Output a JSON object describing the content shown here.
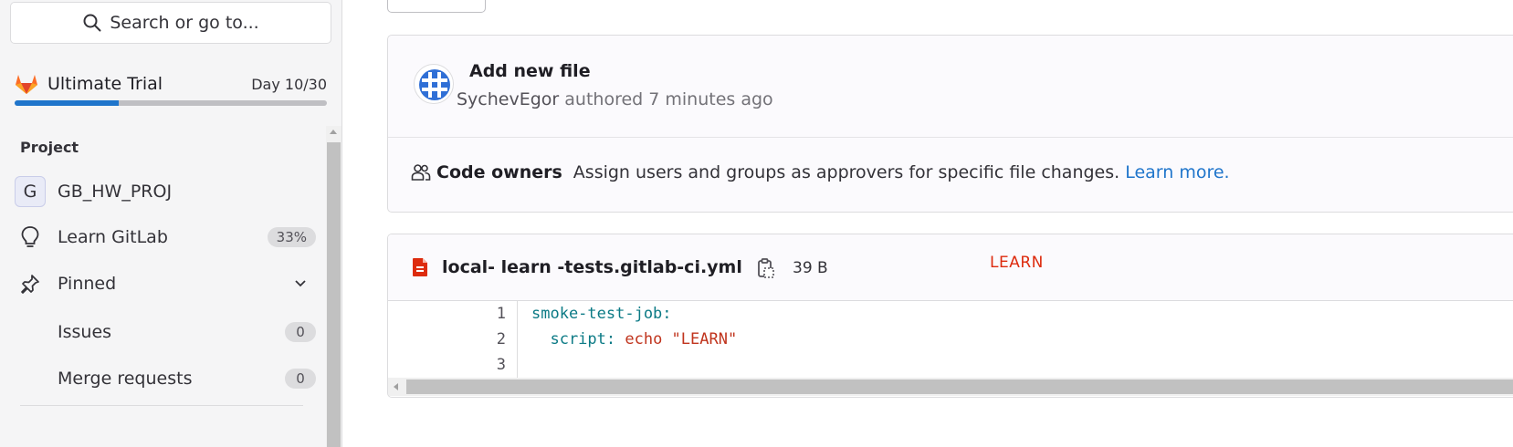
{
  "sidebar": {
    "search_placeholder": "Search or go to...",
    "trial": {
      "title": "Ultimate Trial",
      "day": "Day 10/30",
      "progress": 0.333
    },
    "section_label": "Project",
    "project": {
      "avatar_letter": "G",
      "name": "GB_HW_PROJ"
    },
    "learn": {
      "label": "Learn GitLab",
      "badge": "33%"
    },
    "pinned": {
      "label": "Pinned"
    },
    "pinned_items": [
      {
        "label": "Issues",
        "count": "0"
      },
      {
        "label": "Merge requests",
        "count": "0"
      }
    ]
  },
  "commit": {
    "title": "Add new file",
    "author": "SychevEgor",
    "meta": "authored 7 minutes ago"
  },
  "code_owners": {
    "label": "Code owners",
    "text": "Assign users and groups as approvers for specific file changes.",
    "link": "Learn more."
  },
  "file": {
    "name": "local- learn -tests.gitlab-ci.yml",
    "size": "39 B",
    "flag": "LEARN",
    "lines": [
      {
        "n": "1",
        "key": "smoke-test-job:",
        "cmd": "",
        "arg": ""
      },
      {
        "n": "2",
        "key": "  script:",
        "cmd": " echo",
        "arg": " \"LEARN\""
      },
      {
        "n": "3",
        "key": "",
        "cmd": "",
        "arg": ""
      }
    ]
  },
  "colors": {
    "accent": "#1f75cb",
    "code_key": "#0b7a85",
    "code_string": "#c0341d",
    "file_icon": "#dd2b0e"
  }
}
